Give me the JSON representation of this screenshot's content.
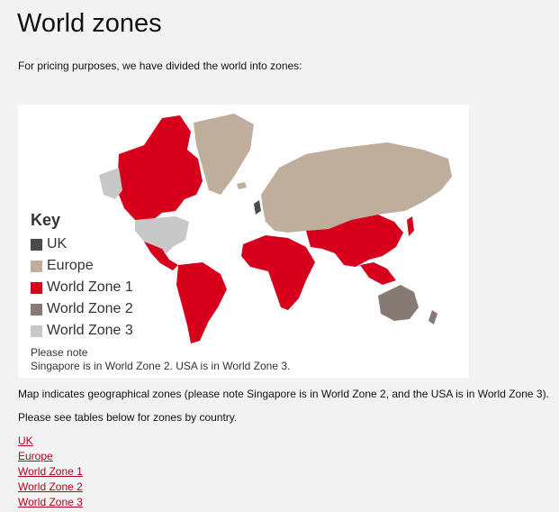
{
  "page": {
    "title": "World zones",
    "intro": "For pricing purposes, we have divided the world into zones:",
    "caption": "Map indicates geographical zones (please note Singapore is in World Zone 2, and the USA is in World Zone 3).",
    "see_tables": "Please see tables below for zones by country."
  },
  "map": {
    "key_title": "Key",
    "legend": [
      {
        "label": "UK",
        "color": "#4a4a4a"
      },
      {
        "label": "Europe",
        "color": "#bfae9c"
      },
      {
        "label": "World Zone 1",
        "color": "#d6001c"
      },
      {
        "label": "World Zone 2",
        "color": "#877a74"
      },
      {
        "label": "World Zone 3",
        "color": "#c8c8c8"
      }
    ],
    "note_title": "Please note",
    "note_text": "Singapore is in World Zone 2. USA is in World Zone 3."
  },
  "links": [
    {
      "label": "UK"
    },
    {
      "label": "Europe"
    },
    {
      "label": "World Zone 1"
    },
    {
      "label": "World Zone 2"
    },
    {
      "label": "World Zone 3"
    }
  ]
}
